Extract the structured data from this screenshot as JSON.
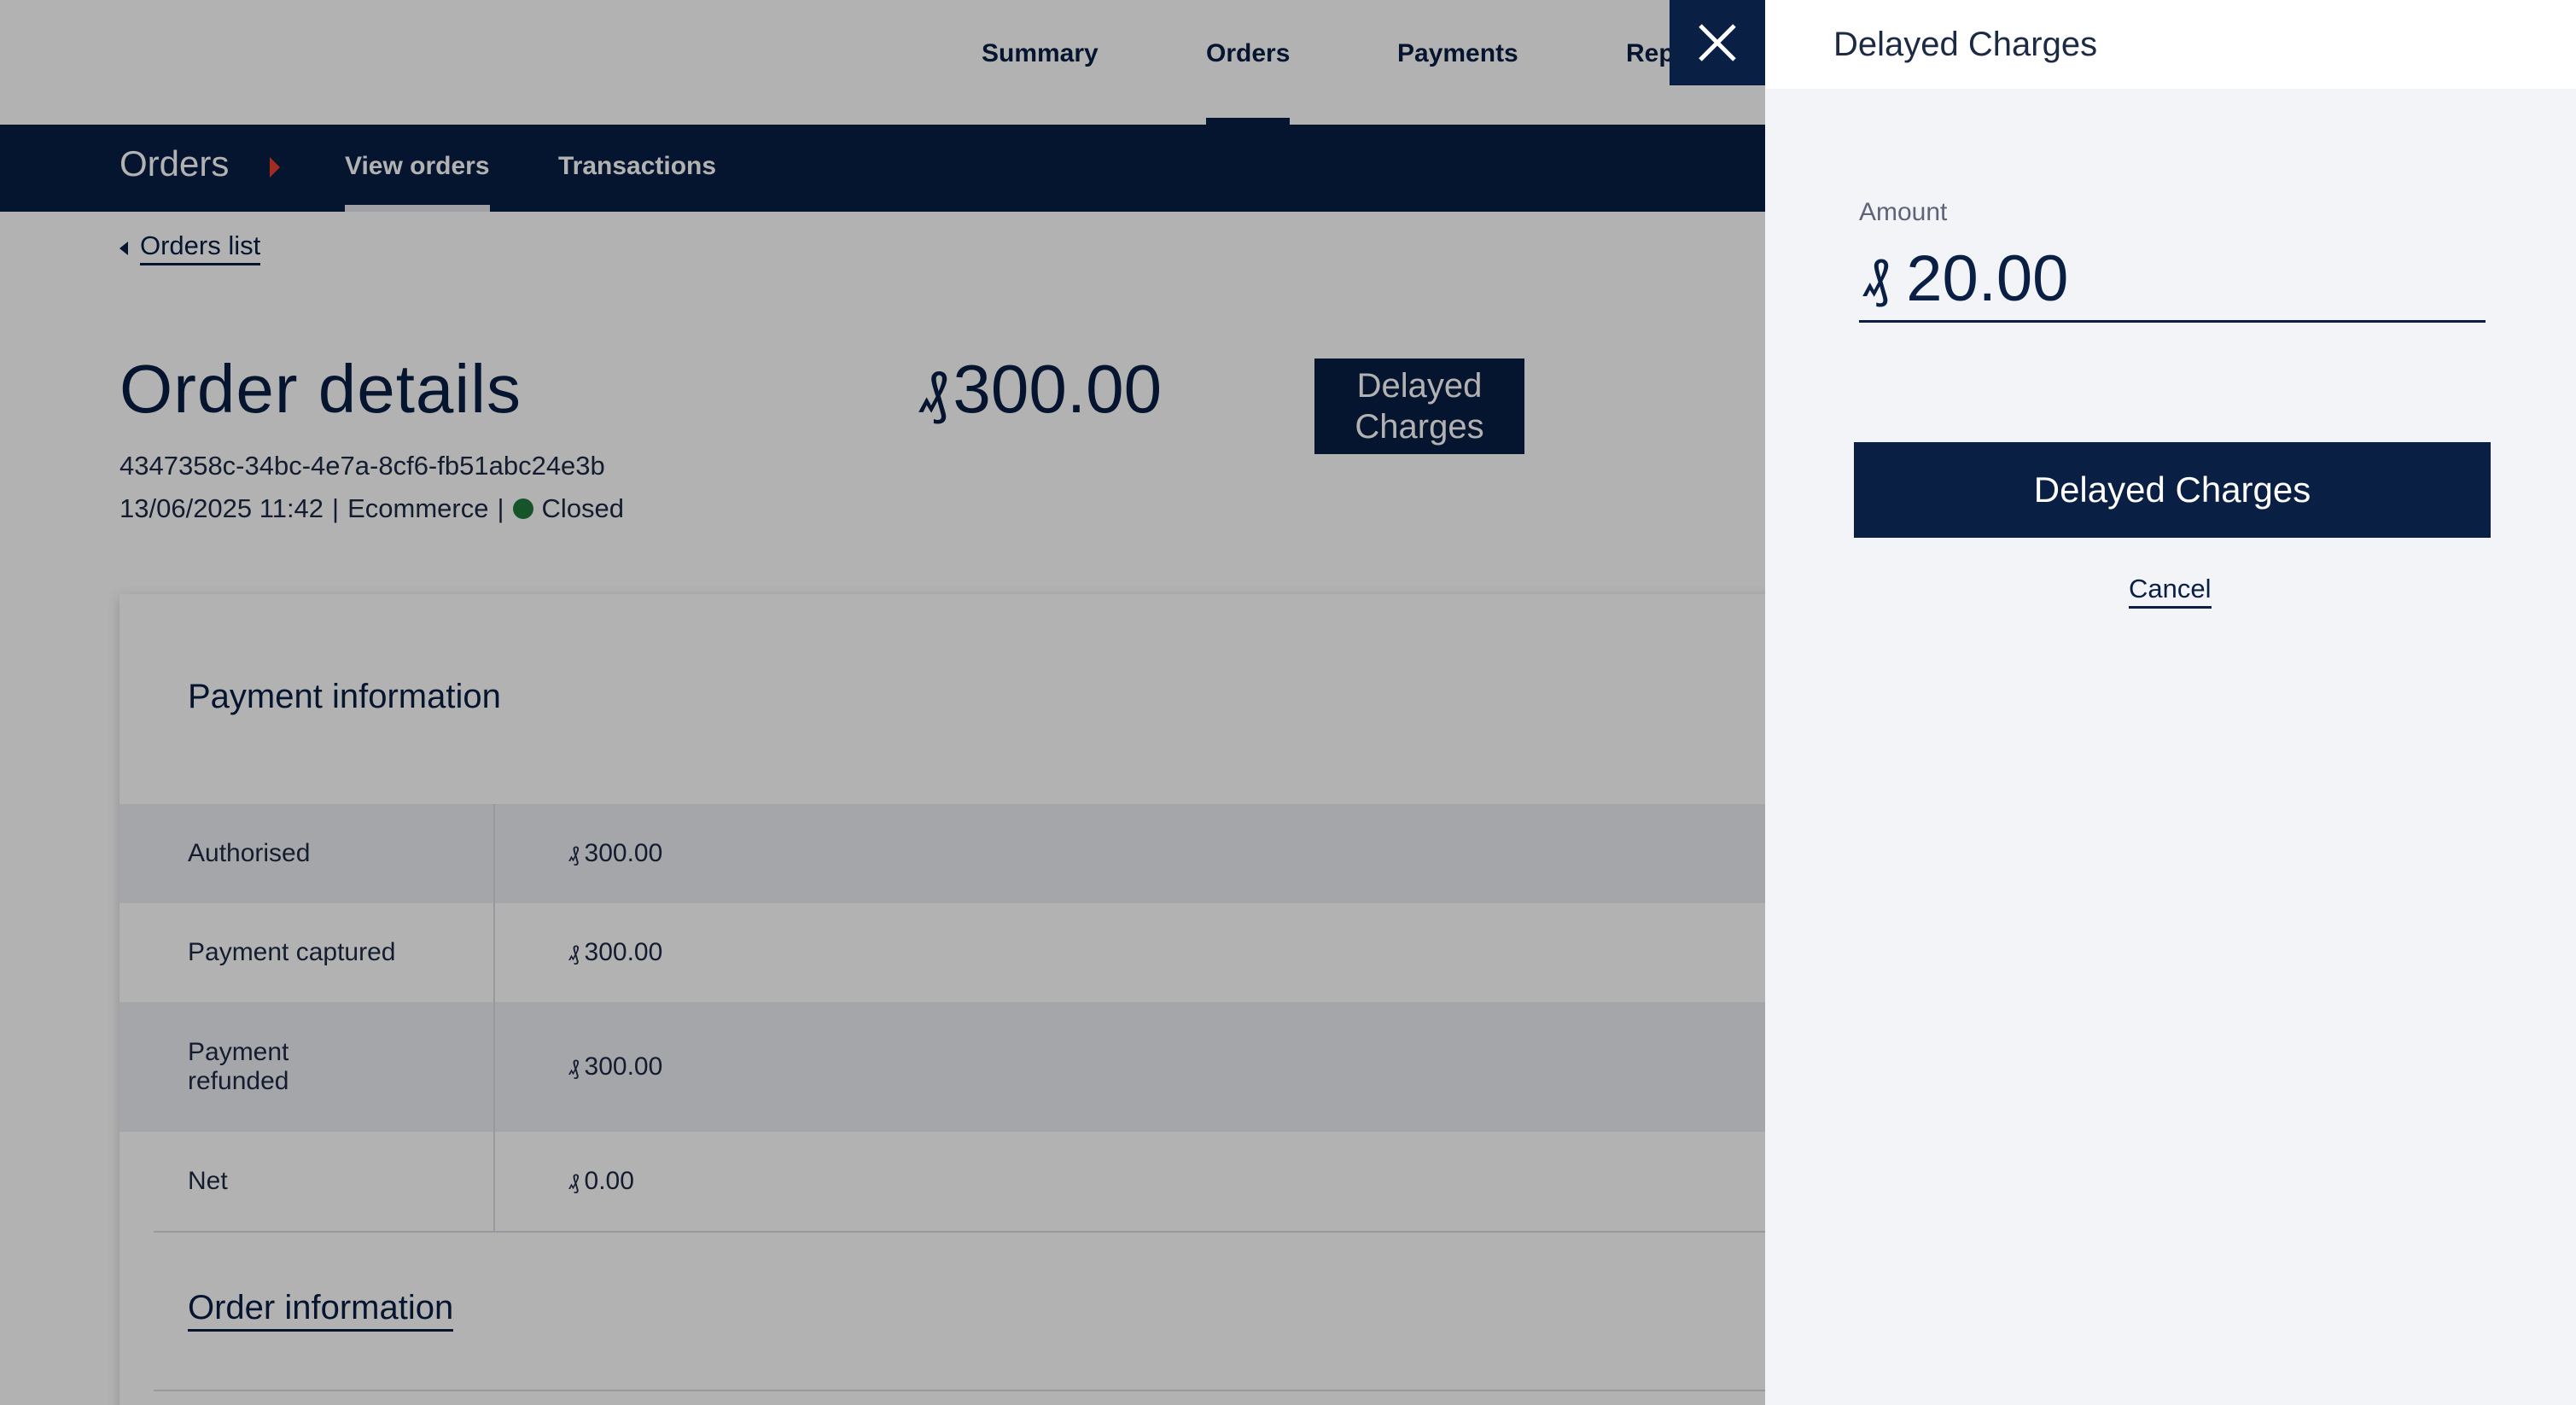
{
  "top_nav": {
    "tabs": [
      {
        "label": "Summary"
      },
      {
        "label": "Orders"
      },
      {
        "label": "Payments"
      },
      {
        "label": "Rep"
      }
    ],
    "active": "Orders"
  },
  "sub_nav": {
    "section": "Orders",
    "tabs": [
      {
        "label": "View orders"
      },
      {
        "label": "Transactions"
      }
    ],
    "active": "View orders"
  },
  "back_link": "Orders list",
  "order": {
    "title": "Order details",
    "currency_symbol": "₰",
    "amount": "300.00",
    "action_button": "Delayed Charges",
    "id": "4347358c-34bc-4e7a-8cf6-fb51abc24e3b",
    "date": "13/06/2025 11:42",
    "channel": "Ecommerce",
    "status": "Closed",
    "status_color": "#1f7a3c"
  },
  "payment_info": {
    "title": "Payment information",
    "rows": [
      {
        "label": "Authorised",
        "value": "300.00"
      },
      {
        "label": "Payment captured",
        "value": "300.00"
      },
      {
        "label": "Payment refunded",
        "value": "300.00"
      },
      {
        "label": "Net",
        "value": "0.00"
      }
    ]
  },
  "order_info_link": "Order information",
  "panel": {
    "title": "Delayed Charges",
    "amount_label": "Amount",
    "currency_symbol": "₰",
    "amount_value": "20.00",
    "submit_label": "Delayed Charges",
    "cancel_label": "Cancel"
  },
  "colors": {
    "brand_navy": "#0a1f44",
    "accent_red": "#e8402f",
    "panel_bg": "#f3f4f8"
  }
}
